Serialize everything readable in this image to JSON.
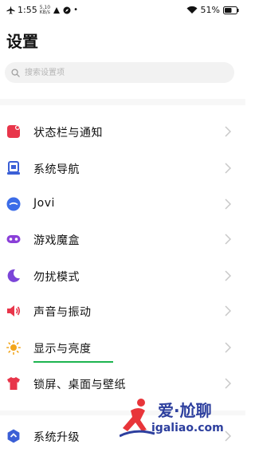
{
  "status_bar": {
    "time": "1:55",
    "net_speed": "5.10",
    "net_unit": "KB/s",
    "battery": "51%"
  },
  "page_title": "设置",
  "search": {
    "placeholder": "搜索设置项"
  },
  "items": [
    {
      "label": "状态栏与通知",
      "icon": "notification-icon",
      "color": "#e8354a"
    },
    {
      "label": "系统导航",
      "icon": "navigation-icon",
      "color": "#3b5fd6"
    },
    {
      "label": "Jovi",
      "icon": "jovi-icon",
      "color": "#3b6ce8"
    },
    {
      "label": "游戏魔盒",
      "icon": "gamepad-icon",
      "color": "#8a3fd8"
    },
    {
      "label": "勿扰模式",
      "icon": "moon-icon",
      "color": "#7b45d8"
    },
    {
      "label": "声音与振动",
      "icon": "speaker-icon",
      "color": "#e8354a"
    },
    {
      "label": "显示与亮度",
      "icon": "sun-icon",
      "color": "#f2a51a"
    },
    {
      "label": "锁屏、桌面与壁纸",
      "icon": "shirt-icon",
      "color": "#e8354a"
    },
    {
      "label": "系统升级",
      "icon": "upgrade-icon",
      "color": "#3b5fd6"
    }
  ],
  "watermark": {
    "top": "爱·尬聊",
    "bottom": "igaliao.com"
  }
}
